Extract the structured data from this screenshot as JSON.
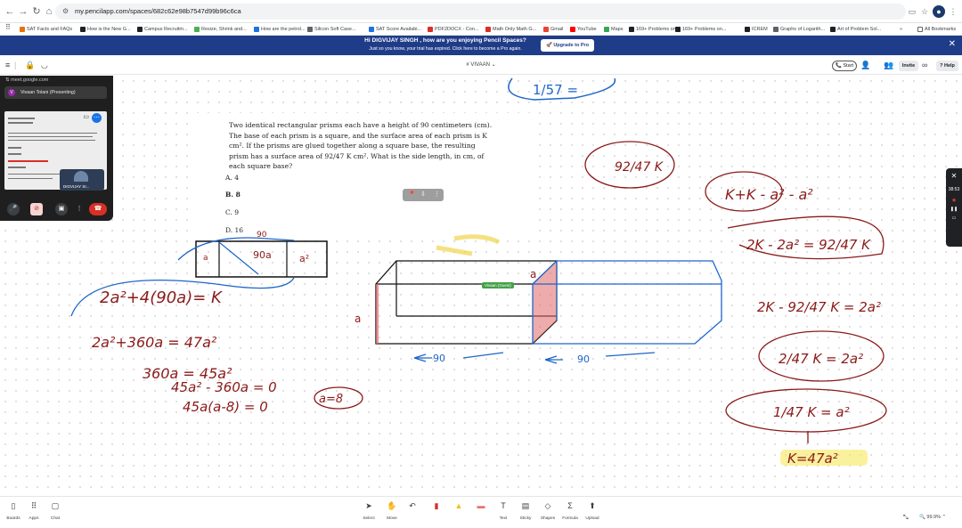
{
  "browser": {
    "url": "my.pencilapp.com/spaces/682c62e98b7547d99b96c6ca",
    "bookmarks": [
      {
        "label": "SAT Facts and FAQs",
        "color": "#e8710a"
      },
      {
        "label": "How is the New G...",
        "color": "#202124"
      },
      {
        "label": "Campus Recruitm...",
        "color": "#202124"
      },
      {
        "label": "Resize, Shrink and...",
        "color": "#4caf50"
      },
      {
        "label": "How are the petrol...",
        "color": "#1a73e8"
      },
      {
        "label": "Silicon Soft Case...",
        "color": "#5f6368"
      },
      {
        "label": "SAT Score Availabi...",
        "color": "#1a73e8"
      },
      {
        "label": "PDF2DOCX - Con...",
        "color": "#d93025"
      },
      {
        "label": "Math Only Math G...",
        "color": "#d93025"
      },
      {
        "label": "Gmail",
        "color": "#ea4335"
      },
      {
        "label": "YouTube",
        "color": "#ff0000"
      },
      {
        "label": "Maps",
        "color": "#34a853"
      },
      {
        "label": "169+ Problems on...",
        "color": "#202124"
      },
      {
        "label": "169+ Problems on...",
        "color": "#202124"
      },
      {
        "label": "ICREM",
        "color": "#202124"
      },
      {
        "label": "Graphs of Logarith...",
        "color": "#5f6368"
      },
      {
        "label": "Art of Problem Sol...",
        "color": "#202124"
      }
    ],
    "bookmarks_more": "»",
    "all_bookmarks": "All Bookmarks"
  },
  "banner": {
    "title": "Hi DIGVIJAY SINGH , how are you enjoying Pencil Spaces?",
    "subtitle": "Just so you know, your trial has expired. Click here to become a Pro again.",
    "upgrade_label": "Upgrade to Pro"
  },
  "toolbar": {
    "board_title": "VIVAAN",
    "start_label": "Start",
    "invite_label": "Invite",
    "help_label": "Help"
  },
  "meet": {
    "url": "meet.google.com",
    "presenting": "Vivaan Tolani (Presenting)",
    "avatar_letter": "V",
    "tile_name": "DIGVIJAY SI..."
  },
  "problem": {
    "text": "Two identical rectangular prisms each have a height of 90 centimeters (cm). The base of each prism is a square, and the surface area of each prism is K cm². If the prisms are glued together along a square base, the resulting prism has a surface area of 92/47 K cm². What is the side length, in cm, of each square base?",
    "choices": [
      {
        "letter": "A.",
        "value": "4"
      },
      {
        "letter": "B.",
        "value": "8"
      },
      {
        "letter": "C.",
        "value": "9"
      },
      {
        "letter": "D.",
        "value": "16"
      }
    ]
  },
  "guest_label": "Vivaan (Guest)",
  "recorder_time": "38:53",
  "bottombar": {
    "left": [
      {
        "label": "Boards",
        "icon": "boards-icon"
      },
      {
        "label": "Apps",
        "icon": "apps-icon"
      },
      {
        "label": "Chat",
        "icon": "chat-icon"
      }
    ],
    "tools": [
      {
        "label": "Select",
        "icon": "select-icon"
      },
      {
        "label": "Move",
        "icon": "move-icon"
      },
      {
        "label": "",
        "icon": "undo-icon"
      },
      {
        "label": "",
        "icon": "pen-icon"
      },
      {
        "label": "",
        "icon": "highlighter-icon"
      },
      {
        "label": "",
        "icon": "eraser-icon"
      },
      {
        "label": "Text",
        "icon": "text-icon"
      },
      {
        "label": "Sticky",
        "icon": "sticky-icon"
      },
      {
        "label": "Shapes",
        "icon": "shapes-icon"
      },
      {
        "label": "Formula",
        "icon": "formula-icon"
      },
      {
        "label": "Upload",
        "icon": "upload-icon"
      }
    ],
    "zoom": "99.9%"
  },
  "handwriting": {
    "l1": "2a²+4(90a)= K",
    "l2": "2a²+360a = 47a²",
    "l3": "360a = 45a²",
    "l4": "45a² - 360a = 0",
    "l5": "45a(a-8) = 0",
    "l6": "a=8",
    "r1": "92/47 K",
    "r2": "K+K - a² - a²",
    "r3": "2K - 2a² = 92/47 K",
    "r4": "2K - 92/47 K = 2a²",
    "r5": "2/47 K = 2a²",
    "r6": "1/47 K = a²",
    "r7": "K=47a²",
    "top": "1/57 =",
    "dim90a": "90",
    "dim90b": "90",
    "dim90c": "90",
    "pa": "a",
    "pa2": "a²",
    "pgoa": "90a"
  }
}
